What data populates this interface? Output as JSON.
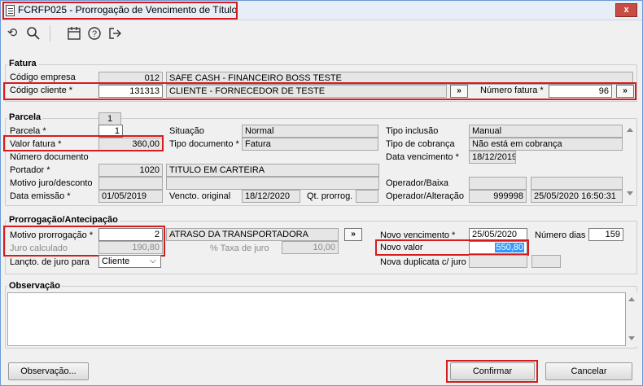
{
  "window": {
    "title": "FCRFP025 - Prorrogação de Vencimento de Título",
    "close_glyph": "x"
  },
  "toolbar": {
    "icons": [
      "undo-icon",
      "search-icon",
      "calendar-icon",
      "help-icon",
      "exit-icon"
    ]
  },
  "fatura": {
    "group_title": "Fatura",
    "codigo_empresa_label": "Código empresa",
    "codigo_empresa_value": "012",
    "empresa_nome": "SAFE CASH - FINANCEIRO BOSS TESTE",
    "codigo_cliente_label": "Código cliente *",
    "codigo_cliente_value": "131313",
    "cliente_nome": "CLIENTE - FORNECEDOR DE TESTE",
    "numero_fatura_label": "Número fatura *",
    "numero_fatura_value": "96",
    "btn_more": "»"
  },
  "parcela": {
    "group_title": "Parcela",
    "parcela_tab": "1",
    "parcela_label": "Parcela *",
    "parcela_value": "1",
    "valor_fatura_label": "Valor fatura *",
    "valor_fatura_value": "360,00",
    "numero_documento_label": "Número documento",
    "portador_label": "Portador *",
    "portador_value": "1020",
    "portador_nome": "TITULO EM CARTEIRA",
    "motivo_label": "Motivo juro/desconto",
    "data_emissao_label": "Data emissão *",
    "data_emissao_value": "01/05/2019",
    "situacao_label": "Situação",
    "situacao_value": "Normal",
    "tipo_documento_label": "Tipo documento *",
    "tipo_documento_value": "Fatura",
    "vencto_original_label": "Vencto. original",
    "vencto_original_value": "18/12/2020",
    "qt_prorrog_label": "Qt. prorrog.",
    "tipo_inclusao_label": "Tipo inclusão",
    "tipo_inclusao_value": "Manual",
    "tipo_cobranca_label": "Tipo de cobrança",
    "tipo_cobranca_value": "Não está em cobrança",
    "data_vencimento_label": "Data vencimento *",
    "data_vencimento_value": "18/12/2019",
    "operador_baixa_label": "Operador/Baixa",
    "operador_alteracao_label": "Operador/Alteração",
    "operador_alteracao_value": "999998",
    "operador_alteracao_data": "25/05/2020 16:50:31"
  },
  "prorrogacao": {
    "group_title": "Prorrogação/Antecipação",
    "motivo_label": "Motivo prorrogação *",
    "motivo_value": "2",
    "motivo_nome": "ATRASO DA TRANSPORTADORA",
    "btn_more": "»",
    "juro_calculado_label": "Juro calculado",
    "juro_calculado_value": "190,80",
    "taxa_juro_label": "% Taxa de juro",
    "taxa_juro_value": "10,00",
    "lancto_label": "Lançto. de juro para",
    "lancto_value": "Cliente",
    "novo_vencimento_label": "Novo vencimento *",
    "novo_vencimento_value": "25/05/2020",
    "numero_dias_label": "Número dias",
    "numero_dias_value": "159",
    "novo_valor_label": "Novo valor",
    "novo_valor_value": "550,80",
    "nova_duplicata_label": "Nova duplicata c/ juro"
  },
  "observacao": {
    "group_title": "Observação"
  },
  "buttons": {
    "observacao": "Observação...",
    "confirmar": "Confirmar",
    "cancelar": "Cancelar"
  }
}
